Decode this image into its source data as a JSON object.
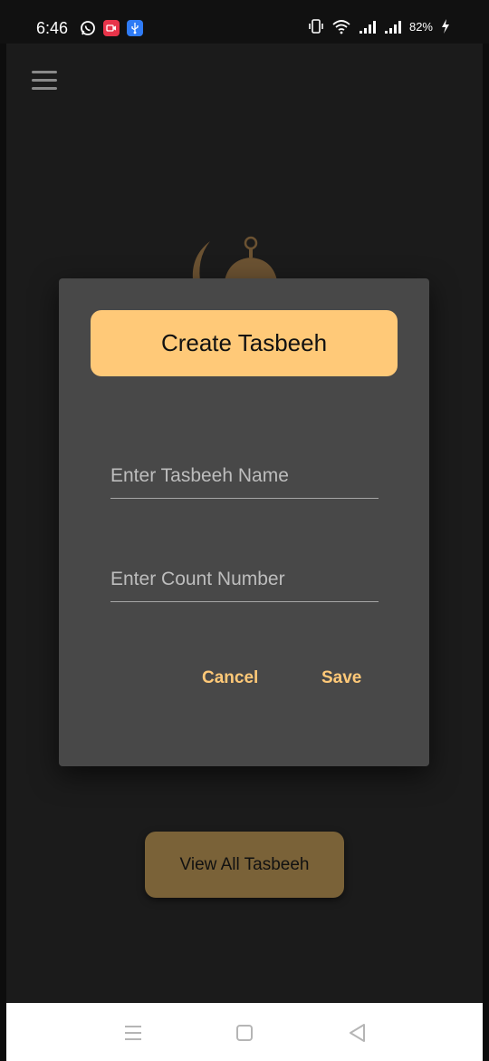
{
  "status_bar": {
    "time": "6:46",
    "battery": "82%",
    "icons": [
      "whatsapp-icon",
      "screen-recorder-icon",
      "usb-icon",
      "vibrate-icon",
      "wifi-icon",
      "signal-icon",
      "signal-icon",
      "charging-icon"
    ]
  },
  "header": {
    "menu_icon": "hamburger-menu-icon"
  },
  "dialog": {
    "title": "Create Tasbeeh",
    "name_placeholder": "Enter Tasbeeh Name",
    "count_placeholder": "Enter Count Number",
    "cancel_label": "Cancel",
    "save_label": "Save"
  },
  "main": {
    "view_all_label": "View All Tasbeeh"
  },
  "nav_bar": {
    "icons": [
      "recent-apps-icon",
      "home-icon",
      "back-icon"
    ]
  },
  "colors": {
    "accent": "#ffc978",
    "button_dim": "#7a6238",
    "dialog_bg": "#484848",
    "app_bg": "#1b1b1b"
  }
}
